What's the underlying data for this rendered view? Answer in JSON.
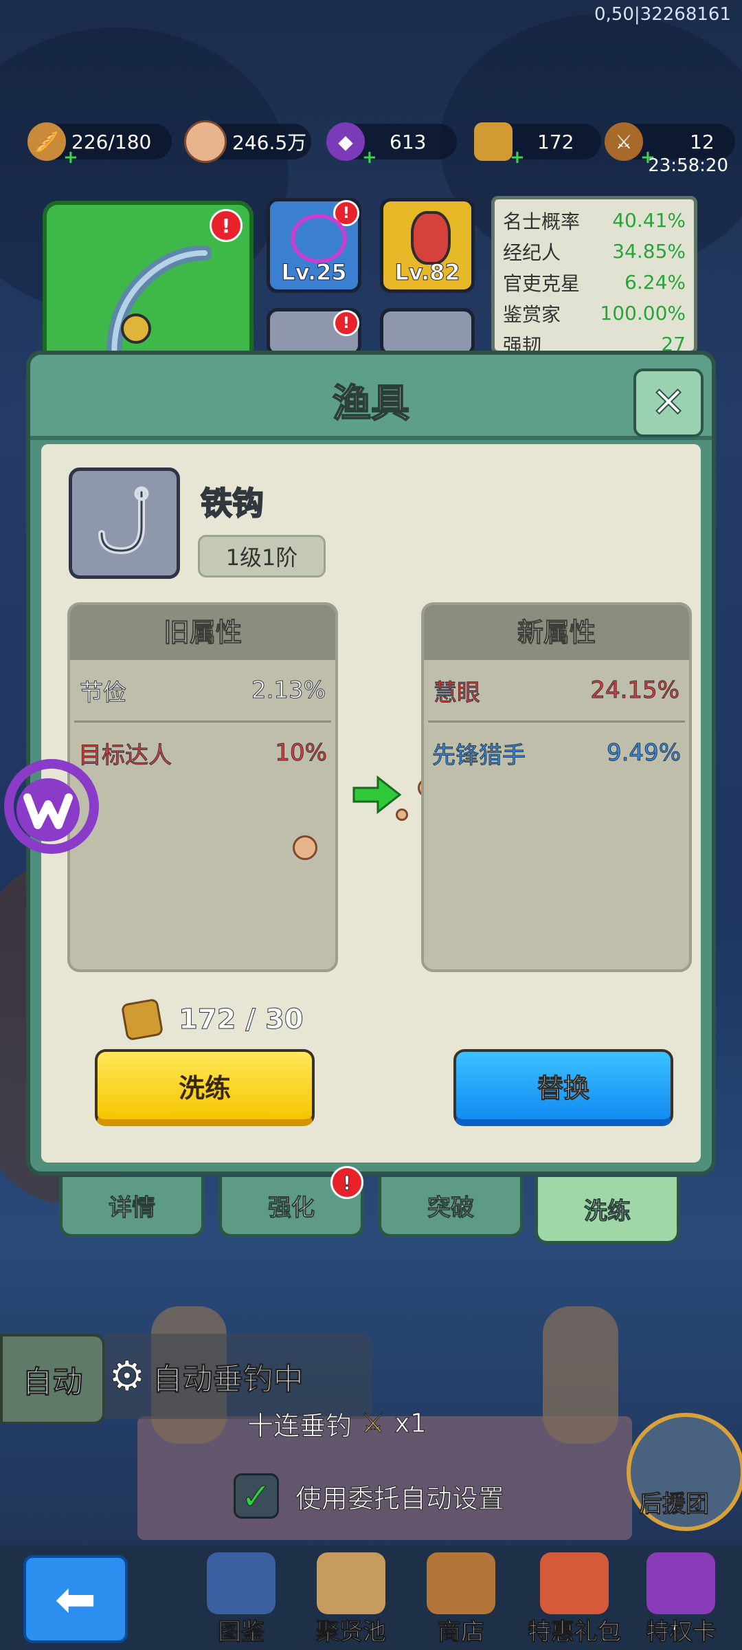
{
  "debug_text": "0,50|32268161",
  "resources": [
    {
      "name": "bait",
      "icon": "bread-icon",
      "value": "226/180",
      "plus": true
    },
    {
      "name": "coins",
      "icon": "coin-icon",
      "value": "246.5万",
      "plus": false
    },
    {
      "name": "gems",
      "icon": "purple-gem-icon",
      "value": "613",
      "plus": true
    },
    {
      "name": "refine-stone",
      "icon": "refine-stone-icon",
      "value": "172",
      "plus": true
    },
    {
      "name": "rods",
      "icon": "rod-icon",
      "value": "12",
      "plus": true
    }
  ],
  "timer": "23:58:20",
  "gear": {
    "slot1_level": "Lv.25",
    "slot2_level": "Lv.82",
    "stats": [
      {
        "label": "名士概率",
        "value": "40.41%"
      },
      {
        "label": "经纪人",
        "value": "34.85%"
      },
      {
        "label": "官吏克星",
        "value": "6.24%"
      },
      {
        "label": "鉴赏家",
        "value": "100.00%"
      },
      {
        "label": "强韧",
        "value": "27"
      }
    ]
  },
  "modal": {
    "title": "渔具",
    "item": {
      "name": "铁钩",
      "level": "1级1阶"
    },
    "old_attr": {
      "header": "旧属性",
      "rows": [
        {
          "label": "节俭",
          "value": "2.13%",
          "color": "#ffffff"
        },
        {
          "label": "目标达人",
          "value": "10%",
          "color": "#e43a3a"
        }
      ]
    },
    "new_attr": {
      "header": "新属性",
      "rows": [
        {
          "label": "慧眼",
          "value": "24.15%",
          "color": "#e43a3a"
        },
        {
          "label": "先锋猎手",
          "value": "9.49%",
          "color": "#2f8ff0"
        }
      ]
    },
    "cost": "172 / 30",
    "refine_button": "洗练",
    "replace_button": "替换"
  },
  "tabs": [
    {
      "label": "详情",
      "active": false
    },
    {
      "label": "强化",
      "active": false,
      "badge": "!"
    },
    {
      "label": "突破",
      "active": false
    },
    {
      "label": "洗练",
      "active": true
    }
  ],
  "game": {
    "auto_button": "自动",
    "auto_status": "自动垂钓中",
    "ten_cast": "十连垂钓",
    "ten_cast_count": "x1",
    "use_settings": "使用委托自动设置",
    "support": "后援团"
  },
  "nav": [
    {
      "label": "图鉴",
      "icon": "book-icon"
    },
    {
      "label": "聚贤池",
      "icon": "scroll-map-icon"
    },
    {
      "label": "商店",
      "icon": "shop-icon"
    },
    {
      "label": "特惠礼包",
      "icon": "gift-pack-icon"
    },
    {
      "label": "特权卡",
      "icon": "privilege-card-icon"
    }
  ],
  "colors": {
    "green": "#27a53a",
    "red": "#e43a3a",
    "blue": "#2f8ff0",
    "accent": "#f6c500"
  }
}
